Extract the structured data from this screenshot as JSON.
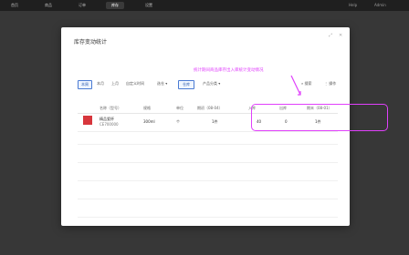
{
  "topbar": {
    "tabs": [
      {
        "label": "首页",
        "active": false
      },
      {
        "label": "商品",
        "active": false
      },
      {
        "label": "订单",
        "active": false
      },
      {
        "label": "库存",
        "active": true
      },
      {
        "label": "设置",
        "active": false
      }
    ],
    "right_items": [
      "Help",
      "Admin"
    ]
  },
  "modal": {
    "title": "库存变动统计",
    "controls": {
      "expand_icon": "expand-icon",
      "close_icon": "close-icon"
    },
    "annotation": "统计期间商品库存出入库统计变动情况",
    "filters": {
      "segments": [
        {
          "label": "本周",
          "active": true
        },
        {
          "label": "本月",
          "active": false
        },
        {
          "label": "上月",
          "active": false
        },
        {
          "label": "自定义时间",
          "active": false
        }
      ],
      "dropdown_1": "选仓",
      "pill": "仓库",
      "dropdown_2": "产品分类",
      "right_action": "搜索",
      "right_more": "⋮ 操作"
    },
    "table": {
      "columns": [
        "名称（型号）",
        "规格",
        "单位",
        "期初（08-04）",
        "入库",
        "出库",
        "期末（08-01）"
      ],
      "rows": [
        {
          "name": "精品瓷杯",
          "sku": "CE700000",
          "spec": "300ml",
          "unit": "个",
          "opening": "1件",
          "in": "40",
          "out": "0",
          "closing": "1件"
        }
      ]
    }
  }
}
